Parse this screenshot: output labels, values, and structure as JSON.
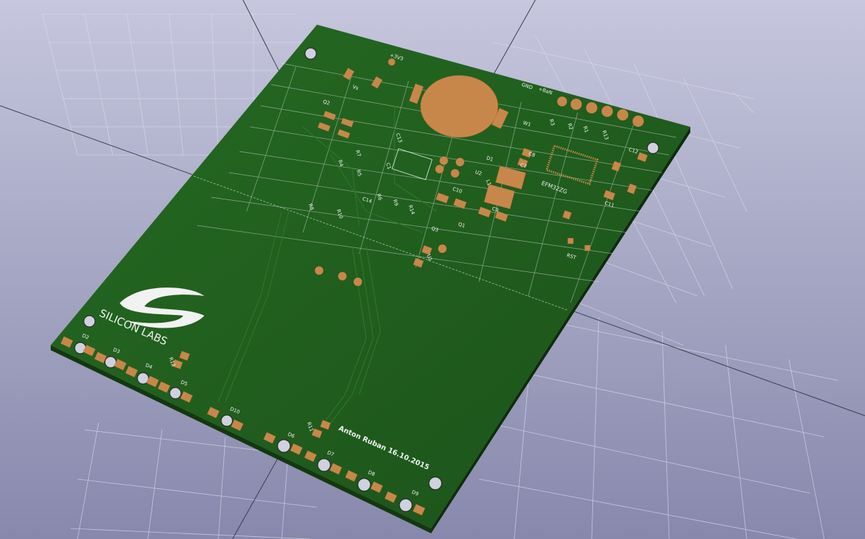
{
  "board": {
    "logo_text": "SILICON LABS",
    "author_text": "Anton Ruban 16.10.2015",
    "mcu_label": "EFM32ZG",
    "colors": {
      "solder_mask": "#1f5a1c",
      "copper": "#c8874a",
      "silkscreen": "#f2f2f2",
      "background": "#a9aac6"
    }
  },
  "labels": [
    {
      "text": "+3V3"
    },
    {
      "text": "Vs"
    },
    {
      "text": "GND"
    },
    {
      "text": "+BaN"
    },
    {
      "text": "W1"
    },
    {
      "text": "R3"
    },
    {
      "text": "R2"
    },
    {
      "text": "R1"
    },
    {
      "text": "R13"
    },
    {
      "text": "C12"
    },
    {
      "text": "C13"
    },
    {
      "text": "C7"
    },
    {
      "text": "C8"
    },
    {
      "text": "C10"
    },
    {
      "text": "C9"
    },
    {
      "text": "C11"
    },
    {
      "text": "C14"
    },
    {
      "text": "C1"
    },
    {
      "text": "D1"
    },
    {
      "text": "U2"
    },
    {
      "text": "L1"
    },
    {
      "text": "Q1"
    },
    {
      "text": "Q2"
    },
    {
      "text": "Q3"
    },
    {
      "text": "R8"
    },
    {
      "text": "R10"
    },
    {
      "text": "R7"
    },
    {
      "text": "R4"
    },
    {
      "text": "R5"
    },
    {
      "text": "R14"
    },
    {
      "text": "U1"
    },
    {
      "text": "RST"
    },
    {
      "text": "R6"
    },
    {
      "text": "R9"
    },
    {
      "text": "D2"
    },
    {
      "text": "D3"
    },
    {
      "text": "D4"
    },
    {
      "text": "D5"
    },
    {
      "text": "D6"
    },
    {
      "text": "D7"
    },
    {
      "text": "D8"
    },
    {
      "text": "D9"
    },
    {
      "text": "D10"
    },
    {
      "text": "R11"
    },
    {
      "text": "R12"
    }
  ]
}
